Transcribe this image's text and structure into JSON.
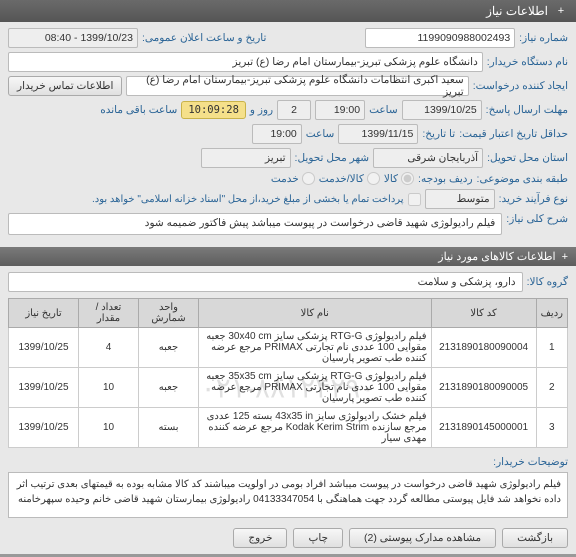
{
  "titlebar": {
    "title": "اطلاعات نیاز"
  },
  "labels": {
    "need_no": "شماره نیاز:",
    "pub_datetime": "تاریخ و ساعت اعلان عمومی:",
    "buyer_org": "نام دستگاه خریدار:",
    "creator": "ایجاد کننده درخواست:",
    "contact_btn": "اطلاعات تماس خریدار",
    "deadline_send": "مهلت ارسال پاسخ:",
    "time_lbl": "ساعت",
    "day_lbl": "روز و",
    "remain_lbl": "ساعت باقی مانده",
    "min_valid": "حداقل تاریخ اعتبار قیمت:",
    "until": "تا تاریخ:",
    "delivery_province": "استان محل تحویل:",
    "delivery_city": "شهر محل تحویل:",
    "budget_class": "طبقه بندی موضوعی:",
    "budget_row": "ردیف بودجه:",
    "goods": "کالا",
    "service": "کالا/خدمت",
    "service_only": "خدمت",
    "purchase_type": "نوع فرآیند خرید:",
    "purchase_note": "پرداخت تمام یا بخشی از مبلغ خرید،از محل \"اسناد خزانه اسلامی\" خواهد بود.",
    "main_desc": "شرح کلی نیاز:",
    "goods_info": "اطلاعات کالاهای مورد نیاز",
    "goods_group": "گروه کالا:",
    "buyer_notes": "توضیحات خریدار:"
  },
  "values": {
    "need_no": "1199090988002493",
    "pub_datetime": "1399/10/23 - 08:40",
    "buyer_org": "دانشگاه علوم پزشکی تبریز-بیمارستان امام رضا (ع) تبریز",
    "creator": "سعید اکبری انتظامات دانشگاه علوم پزشکی تبریز-بیمارستان امام رضا (ع) تبریز",
    "deadline_date": "1399/10/25",
    "deadline_time": "19:00",
    "days_remain": "2",
    "countdown": "10:09:28",
    "until_date": "1399/11/15",
    "until_time": "19:00",
    "province": "آذربایجان شرقی",
    "city": "تبریز",
    "purchase_type": "متوسط",
    "main_desc": "فیلم رادیولوژی شهید قاضی درخواست در پیوست میباشد پیش فاکتور ضمیمه شود",
    "goods_group": "دارو، پزشکی و سلامت",
    "buyer_notes": "فیلم رادیولوژی شهید قاضی درخواست در پیوست میباشد افراد بومی در اولویت میباشند کد کالا مشابه بوده به قیمتهای بعدی ترتیب اثر داده نخواهد شد فایل پیوستی مطالعه گردد جهت هماهنگی با 04133347054 رادیولوژی بیمارستان شهید قاضی خانم وحیده سپهرخامنه"
  },
  "table": {
    "headers": [
      "ردیف",
      "کد کالا",
      "نام کالا",
      "واحد شمارش",
      "تعداد / مقدار",
      "تاریخ نیاز"
    ],
    "rows": [
      {
        "n": "1",
        "code": "2131890180090004",
        "name": "فیلم رادیولوژی RTG-G پزشکی سایز 30x40 cm جعبه مقوایی 100 عددی نام تجارتی PRIMAX مرجع عرضه کننده طب تصویر پارسیان",
        "unit": "جعبه",
        "qty": "4",
        "date": "1399/10/25"
      },
      {
        "n": "2",
        "code": "2131890180090005",
        "name": "فیلم رادیولوژی RTG-G پزشکی سایز 35x35 cm جعبه مقوایی 100 عددی نام تجارتی PRIMAX مرجع عرضه کننده طب تصویر پارسیان",
        "unit": "جعبه",
        "qty": "10",
        "date": "1399/10/25"
      },
      {
        "n": "3",
        "code": "2131890145000001",
        "name": "فیلم خشک رادیولوژی سایز 43x35 in بسته 125 عددی مرجع سازنده Kodak Kerim Strim مرجع عرضه کننده مهدی سیار",
        "unit": "بسته",
        "qty": "10",
        "date": "1399/10/25"
      }
    ]
  },
  "footer": {
    "back": "بازگشت",
    "attach": "مشاهده مدارک پیوستی (2)",
    "print": "چاپ",
    "exit": "خروج"
  },
  "watermark": "۰۲۱-۸۸۱۲۴۲۹۰"
}
